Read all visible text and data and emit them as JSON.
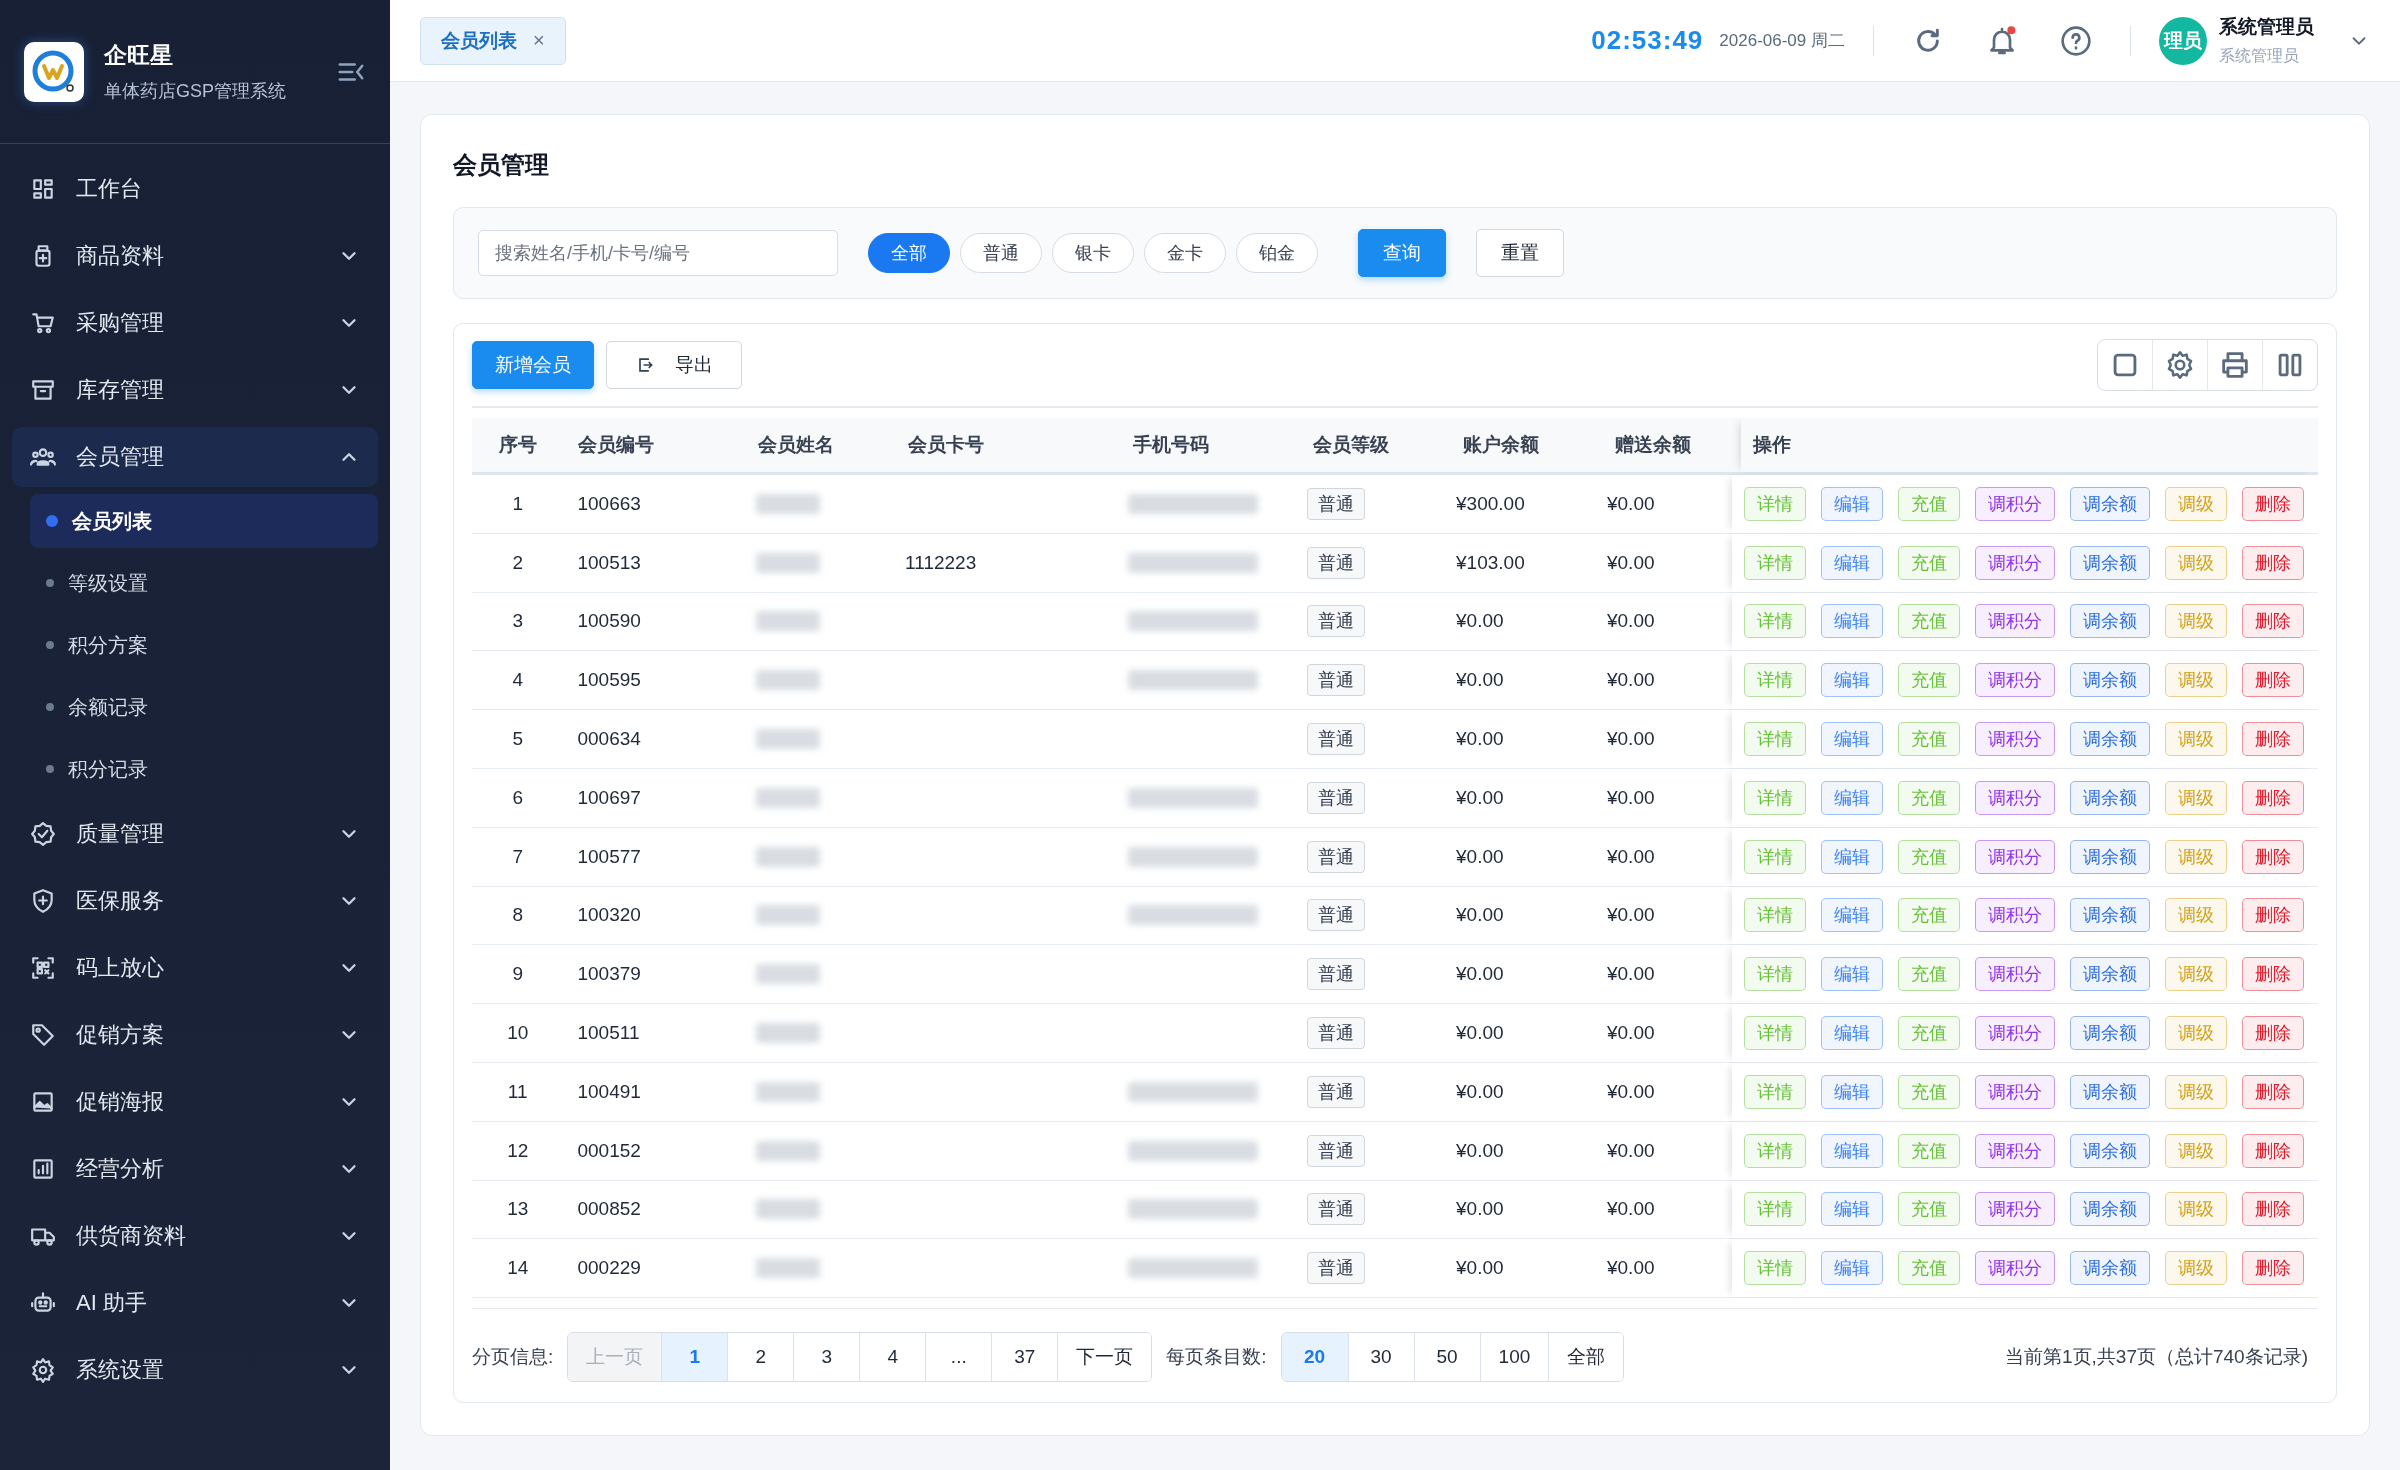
{
  "brand": {
    "name": "企旺星",
    "subtitle": "单体药店GSP管理系统"
  },
  "sidebar": {
    "items": [
      {
        "label": "工作台",
        "kind": "link",
        "selected": false
      },
      {
        "label": "商品资料",
        "kind": "group",
        "expanded": false,
        "selected": false
      },
      {
        "label": "采购管理",
        "kind": "group",
        "expanded": false,
        "selected": false
      },
      {
        "label": "库存管理",
        "kind": "group",
        "expanded": false,
        "selected": false
      },
      {
        "label": "会员管理",
        "kind": "group",
        "expanded": true,
        "selected": true,
        "children": [
          {
            "label": "会员列表",
            "selected": true
          },
          {
            "label": "等级设置",
            "selected": false
          },
          {
            "label": "积分方案",
            "selected": false
          },
          {
            "label": "余额记录",
            "selected": false
          },
          {
            "label": "积分记录",
            "selected": false
          }
        ]
      },
      {
        "label": "质量管理",
        "kind": "group",
        "expanded": false,
        "selected": false
      },
      {
        "label": "医保服务",
        "kind": "group",
        "expanded": false,
        "selected": false
      },
      {
        "label": "码上放心",
        "kind": "group",
        "expanded": false,
        "selected": false
      },
      {
        "label": "促销方案",
        "kind": "group",
        "expanded": false,
        "selected": false
      },
      {
        "label": "促销海报",
        "kind": "group",
        "expanded": false,
        "selected": false
      },
      {
        "label": "经营分析",
        "kind": "group",
        "expanded": false,
        "selected": false
      },
      {
        "label": "供货商资料",
        "kind": "group",
        "expanded": false,
        "selected": false
      },
      {
        "label": "AI 助手",
        "kind": "group",
        "expanded": false,
        "selected": false
      },
      {
        "label": "系统设置",
        "kind": "group",
        "expanded": false,
        "selected": false
      }
    ]
  },
  "header": {
    "tabs": [
      {
        "label": "会员列表",
        "selected": true,
        "close": "×"
      }
    ],
    "clock": "02:53:49",
    "date": "2026-06-09 周二",
    "unread": true,
    "user": {
      "avatar": "理员",
      "name": "系统管理员",
      "role": "系统管理员"
    }
  },
  "page": {
    "title": "会员管理"
  },
  "filters": {
    "search": {
      "placeholder": "搜索姓名/手机/卡号/编号"
    },
    "levels": [
      {
        "label": "全部",
        "selected": true
      },
      {
        "label": "普通",
        "selected": false
      },
      {
        "label": "银卡",
        "selected": false
      },
      {
        "label": "金卡",
        "selected": false
      },
      {
        "label": "铂金",
        "selected": false
      }
    ],
    "buttons": [
      {
        "label": "查询",
        "kind": "primary"
      },
      {
        "label": "重置",
        "kind": "plain"
      }
    ]
  },
  "toolbar": {
    "add": "新增会员",
    "export": "导出"
  },
  "table": {
    "columns": [
      "序号",
      "会员编号",
      "会员姓名",
      "会员卡号",
      "手机号码",
      "会员等级",
      "账户余额",
      "赠送余额",
      "操作"
    ],
    "rows": [
      {
        "no": "1",
        "code": "100663",
        "name_hidden": true,
        "card": "",
        "phone_hidden": true,
        "level": "普通",
        "balance": "¥300.00",
        "gift": "¥0.00",
        "actions": [
          {
            "label": "详情",
            "color": "#67c23a"
          },
          {
            "label": "编辑",
            "color": "#3b82f6"
          },
          {
            "label": "充值",
            "color": "#67c23a"
          },
          {
            "label": "调积分",
            "color": "#9333ea"
          },
          {
            "label": "调余额",
            "color": "#2f6fe0"
          },
          {
            "label": "调级",
            "color": "#d4a017"
          },
          {
            "label": "删除",
            "color": "#e11d2e"
          }
        ]
      },
      {
        "no": "2",
        "code": "100513",
        "name_hidden": true,
        "card": "1112223",
        "phone_hidden": true,
        "level": "普通",
        "balance": "¥103.00",
        "gift": "¥0.00",
        "actions": [
          {
            "label": "详情",
            "color": "#67c23a"
          },
          {
            "label": "编辑",
            "color": "#3b82f6"
          },
          {
            "label": "充值",
            "color": "#67c23a"
          },
          {
            "label": "调积分",
            "color": "#9333ea"
          },
          {
            "label": "调余额",
            "color": "#2f6fe0"
          },
          {
            "label": "调级",
            "color": "#d4a017"
          },
          {
            "label": "删除",
            "color": "#e11d2e"
          }
        ]
      },
      {
        "no": "3",
        "code": "100590",
        "name_hidden": true,
        "card": "",
        "phone_hidden": true,
        "level": "普通",
        "balance": "¥0.00",
        "gift": "¥0.00",
        "actions": [
          {
            "label": "详情",
            "color": "#67c23a"
          },
          {
            "label": "编辑",
            "color": "#3b82f6"
          },
          {
            "label": "充值",
            "color": "#67c23a"
          },
          {
            "label": "调积分",
            "color": "#9333ea"
          },
          {
            "label": "调余额",
            "color": "#2f6fe0"
          },
          {
            "label": "调级",
            "color": "#d4a017"
          },
          {
            "label": "删除",
            "color": "#e11d2e"
          }
        ]
      },
      {
        "no": "4",
        "code": "100595",
        "name_hidden": true,
        "card": "",
        "phone_hidden": true,
        "level": "普通",
        "balance": "¥0.00",
        "gift": "¥0.00",
        "actions": [
          {
            "label": "详情",
            "color": "#67c23a"
          },
          {
            "label": "编辑",
            "color": "#3b82f6"
          },
          {
            "label": "充值",
            "color": "#67c23a"
          },
          {
            "label": "调积分",
            "color": "#9333ea"
          },
          {
            "label": "调余额",
            "color": "#2f6fe0"
          },
          {
            "label": "调级",
            "color": "#d4a017"
          },
          {
            "label": "删除",
            "color": "#e11d2e"
          }
        ]
      },
      {
        "no": "5",
        "code": "000634",
        "name_hidden": true,
        "card": "",
        "phone_hidden": false,
        "level": "普通",
        "balance": "¥0.00",
        "gift": "¥0.00",
        "actions": [
          {
            "label": "详情",
            "color": "#67c23a"
          },
          {
            "label": "编辑",
            "color": "#3b82f6"
          },
          {
            "label": "充值",
            "color": "#67c23a"
          },
          {
            "label": "调积分",
            "color": "#9333ea"
          },
          {
            "label": "调余额",
            "color": "#2f6fe0"
          },
          {
            "label": "调级",
            "color": "#d4a017"
          },
          {
            "label": "删除",
            "color": "#e11d2e"
          }
        ]
      },
      {
        "no": "6",
        "code": "100697",
        "name_hidden": true,
        "card": "",
        "phone_hidden": true,
        "level": "普通",
        "balance": "¥0.00",
        "gift": "¥0.00",
        "actions": [
          {
            "label": "详情",
            "color": "#67c23a"
          },
          {
            "label": "编辑",
            "color": "#3b82f6"
          },
          {
            "label": "充值",
            "color": "#67c23a"
          },
          {
            "label": "调积分",
            "color": "#9333ea"
          },
          {
            "label": "调余额",
            "color": "#2f6fe0"
          },
          {
            "label": "调级",
            "color": "#d4a017"
          },
          {
            "label": "删除",
            "color": "#e11d2e"
          }
        ]
      },
      {
        "no": "7",
        "code": "100577",
        "name_hidden": true,
        "card": "",
        "phone_hidden": true,
        "level": "普通",
        "balance": "¥0.00",
        "gift": "¥0.00",
        "actions": [
          {
            "label": "详情",
            "color": "#67c23a"
          },
          {
            "label": "编辑",
            "color": "#3b82f6"
          },
          {
            "label": "充值",
            "color": "#67c23a"
          },
          {
            "label": "调积分",
            "color": "#9333ea"
          },
          {
            "label": "调余额",
            "color": "#2f6fe0"
          },
          {
            "label": "调级",
            "color": "#d4a017"
          },
          {
            "label": "删除",
            "color": "#e11d2e"
          }
        ]
      },
      {
        "no": "8",
        "code": "100320",
        "name_hidden": true,
        "card": "",
        "phone_hidden": true,
        "level": "普通",
        "balance": "¥0.00",
        "gift": "¥0.00",
        "actions": [
          {
            "label": "详情",
            "color": "#67c23a"
          },
          {
            "label": "编辑",
            "color": "#3b82f6"
          },
          {
            "label": "充值",
            "color": "#67c23a"
          },
          {
            "label": "调积分",
            "color": "#9333ea"
          },
          {
            "label": "调余额",
            "color": "#2f6fe0"
          },
          {
            "label": "调级",
            "color": "#d4a017"
          },
          {
            "label": "删除",
            "color": "#e11d2e"
          }
        ]
      },
      {
        "no": "9",
        "code": "100379",
        "name_hidden": true,
        "card": "",
        "phone_hidden": false,
        "level": "普通",
        "balance": "¥0.00",
        "gift": "¥0.00",
        "actions": [
          {
            "label": "详情",
            "color": "#67c23a"
          },
          {
            "label": "编辑",
            "color": "#3b82f6"
          },
          {
            "label": "充值",
            "color": "#67c23a"
          },
          {
            "label": "调积分",
            "color": "#9333ea"
          },
          {
            "label": "调余额",
            "color": "#2f6fe0"
          },
          {
            "label": "调级",
            "color": "#d4a017"
          },
          {
            "label": "删除",
            "color": "#e11d2e"
          }
        ]
      },
      {
        "no": "10",
        "code": "100511",
        "name_hidden": true,
        "card": "",
        "phone_hidden": false,
        "level": "普通",
        "balance": "¥0.00",
        "gift": "¥0.00",
        "actions": [
          {
            "label": "详情",
            "color": "#67c23a"
          },
          {
            "label": "编辑",
            "color": "#3b82f6"
          },
          {
            "label": "充值",
            "color": "#67c23a"
          },
          {
            "label": "调积分",
            "color": "#9333ea"
          },
          {
            "label": "调余额",
            "color": "#2f6fe0"
          },
          {
            "label": "调级",
            "color": "#d4a017"
          },
          {
            "label": "删除",
            "color": "#e11d2e"
          }
        ]
      },
      {
        "no": "11",
        "code": "100491",
        "name_hidden": true,
        "card": "",
        "phone_hidden": true,
        "level": "普通",
        "balance": "¥0.00",
        "gift": "¥0.00",
        "actions": [
          {
            "label": "详情",
            "color": "#67c23a"
          },
          {
            "label": "编辑",
            "color": "#3b82f6"
          },
          {
            "label": "充值",
            "color": "#67c23a"
          },
          {
            "label": "调积分",
            "color": "#9333ea"
          },
          {
            "label": "调余额",
            "color": "#2f6fe0"
          },
          {
            "label": "调级",
            "color": "#d4a017"
          },
          {
            "label": "删除",
            "color": "#e11d2e"
          }
        ]
      },
      {
        "no": "12",
        "code": "000152",
        "name_hidden": true,
        "card": "",
        "phone_hidden": true,
        "level": "普通",
        "balance": "¥0.00",
        "gift": "¥0.00",
        "actions": [
          {
            "label": "详情",
            "color": "#67c23a"
          },
          {
            "label": "编辑",
            "color": "#3b82f6"
          },
          {
            "label": "充值",
            "color": "#67c23a"
          },
          {
            "label": "调积分",
            "color": "#9333ea"
          },
          {
            "label": "调余额",
            "color": "#2f6fe0"
          },
          {
            "label": "调级",
            "color": "#d4a017"
          },
          {
            "label": "删除",
            "color": "#e11d2e"
          }
        ]
      },
      {
        "no": "13",
        "code": "000852",
        "name_hidden": true,
        "card": "",
        "phone_hidden": true,
        "level": "普通",
        "balance": "¥0.00",
        "gift": "¥0.00",
        "actions": [
          {
            "label": "详情",
            "color": "#67c23a"
          },
          {
            "label": "编辑",
            "color": "#3b82f6"
          },
          {
            "label": "充值",
            "color": "#67c23a"
          },
          {
            "label": "调积分",
            "color": "#9333ea"
          },
          {
            "label": "调余额",
            "color": "#2f6fe0"
          },
          {
            "label": "调级",
            "color": "#d4a017"
          },
          {
            "label": "删除",
            "color": "#e11d2e"
          }
        ]
      },
      {
        "no": "14",
        "code": "000229",
        "name_hidden": true,
        "card": "",
        "phone_hidden": true,
        "level": "普通",
        "balance": "¥0.00",
        "gift": "¥0.00",
        "actions": [
          {
            "label": "详情",
            "color": "#67c23a"
          },
          {
            "label": "编辑",
            "color": "#3b82f6"
          },
          {
            "label": "充值",
            "color": "#67c23a"
          },
          {
            "label": "调积分",
            "color": "#9333ea"
          },
          {
            "label": "调余额",
            "color": "#2f6fe0"
          },
          {
            "label": "调级",
            "color": "#d4a017"
          },
          {
            "label": "删除",
            "color": "#e11d2e"
          }
        ]
      }
    ]
  },
  "pagination": {
    "label": "分页信息:",
    "pages": [
      {
        "label": "上一页",
        "selected": false,
        "disabled": true
      },
      {
        "label": "1",
        "selected": true,
        "disabled": false
      },
      {
        "label": "2",
        "selected": false,
        "disabled": false
      },
      {
        "label": "3",
        "selected": false,
        "disabled": false
      },
      {
        "label": "4",
        "selected": false,
        "disabled": false
      },
      {
        "label": "...",
        "selected": false,
        "disabled": false
      },
      {
        "label": "37",
        "selected": false,
        "disabled": false
      },
      {
        "label": "下一页",
        "selected": false,
        "disabled": false
      }
    ],
    "size_label": "每页条目数:",
    "sizes": [
      {
        "label": "20",
        "selected": true
      },
      {
        "label": "30",
        "selected": false
      },
      {
        "label": "50",
        "selected": false
      },
      {
        "label": "100",
        "selected": false
      },
      {
        "label": "全部",
        "selected": false
      }
    ],
    "summary": "当前第1页,共37页（总计740条记录)"
  }
}
